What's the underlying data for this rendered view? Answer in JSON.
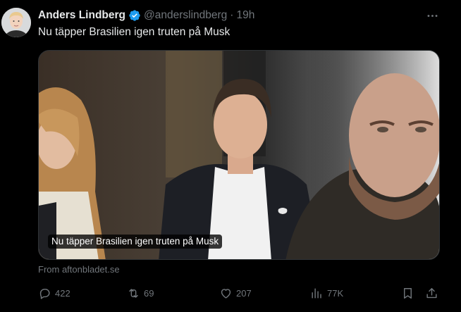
{
  "author": {
    "name": "Anders Lindberg",
    "handle": "@anderslindberg",
    "separator": "·",
    "time": "19h"
  },
  "tweet": {
    "text": "Nu täpper Brasilien igen truten på Musk"
  },
  "media": {
    "caption": "Nu täpper Brasilien igen truten på Musk"
  },
  "source": "From aftonbladet.se",
  "actions": {
    "reply_count": "422",
    "repost_count": "69",
    "like_count": "207",
    "views_count": "77K"
  },
  "icons": {
    "verified": "verified-badge-icon",
    "more": "more-icon",
    "reply": "reply-icon",
    "repost": "repost-icon",
    "like": "heart-icon",
    "views": "views-icon",
    "bookmark": "bookmark-icon",
    "share": "share-icon"
  },
  "colors": {
    "background": "#000000",
    "text": "#e7e9ea",
    "muted": "#71767b",
    "verified": "#1d9bf0"
  }
}
